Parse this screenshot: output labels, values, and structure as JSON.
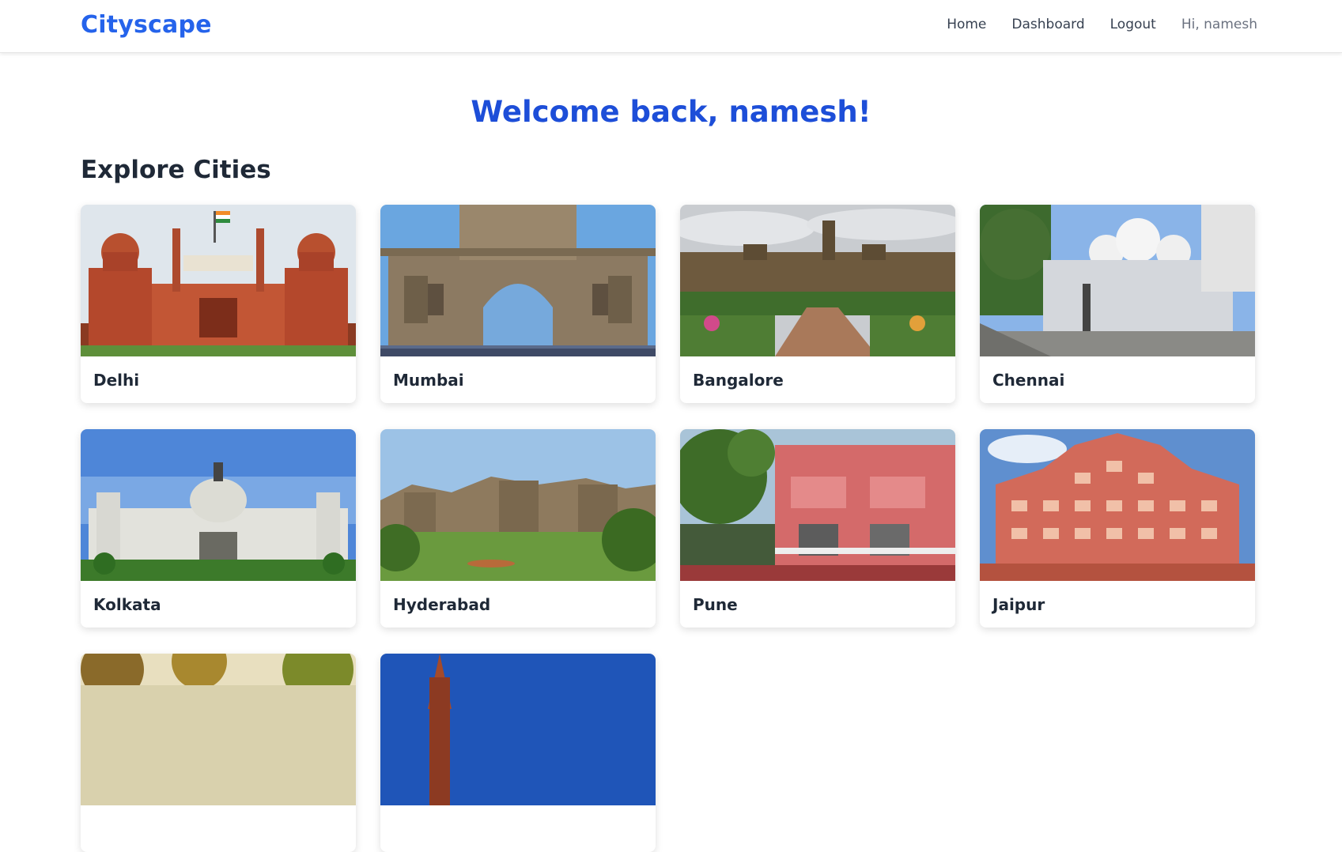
{
  "brand": "Cityscape",
  "nav": {
    "home": "Home",
    "dashboard": "Dashboard",
    "logout": "Logout",
    "greeting": "Hi, namesh"
  },
  "welcome": "Welcome back, namesh!",
  "section_title": "Explore Cities",
  "cities": [
    {
      "name": "Delhi"
    },
    {
      "name": "Mumbai"
    },
    {
      "name": "Bangalore"
    },
    {
      "name": "Chennai"
    },
    {
      "name": "Kolkata"
    },
    {
      "name": "Hyderabad"
    },
    {
      "name": "Pune"
    },
    {
      "name": "Jaipur"
    },
    {
      "name": ""
    },
    {
      "name": ""
    }
  ],
  "colors": {
    "brand": "#2563eb",
    "welcome": "#1d4ed8",
    "text": "#1f2937"
  }
}
